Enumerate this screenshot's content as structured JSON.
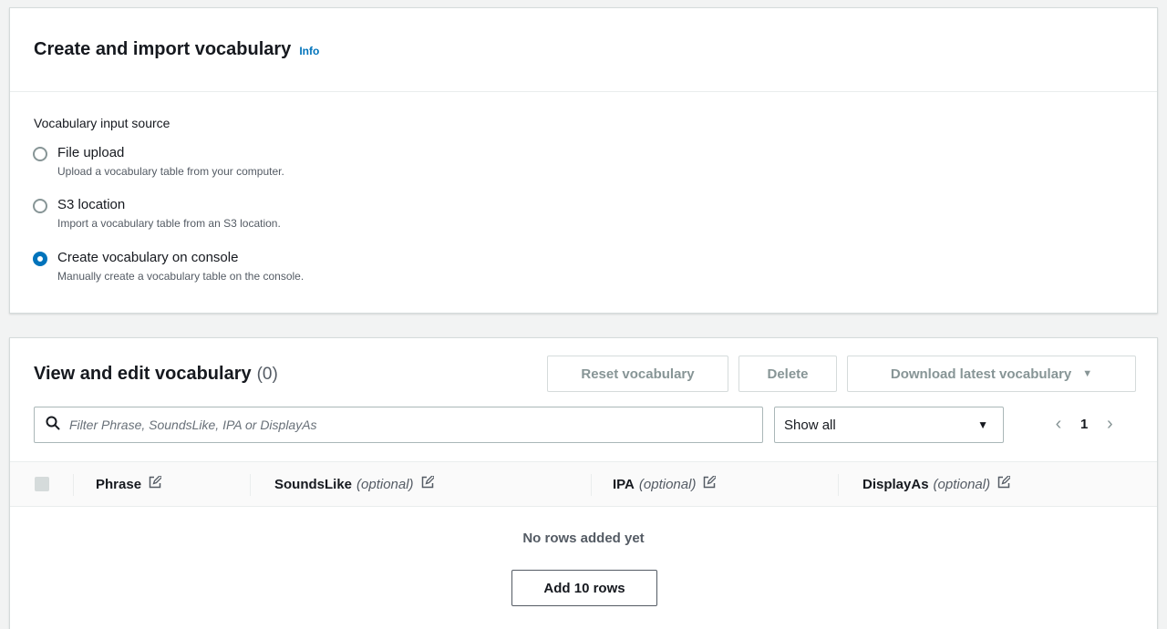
{
  "create_panel": {
    "title": "Create and import vocabulary",
    "info_link": "Info",
    "input_source_label": "Vocabulary input source",
    "options": [
      {
        "title": "File upload",
        "description": "Upload a vocabulary table from your computer.",
        "checked": false
      },
      {
        "title": "S3 location",
        "description": "Import a vocabulary table from an S3 location.",
        "checked": false
      },
      {
        "title": "Create vocabulary on console",
        "description": "Manually create a vocabulary table on the console.",
        "checked": true
      }
    ]
  },
  "edit_panel": {
    "title": "View and edit vocabulary",
    "count": "(0)",
    "buttons": {
      "reset": "Reset vocabulary",
      "delete": "Delete",
      "download": "Download latest vocabulary"
    },
    "filter": {
      "placeholder": "Filter Phrase, SoundsLike, IPA or DisplayAs",
      "value": ""
    },
    "show_select": {
      "selected": "Show all"
    },
    "pagination": {
      "current_page": "1"
    },
    "table": {
      "columns": [
        {
          "name": "Phrase",
          "optional": ""
        },
        {
          "name": "SoundsLike",
          "optional": "(optional)"
        },
        {
          "name": "IPA",
          "optional": "(optional)"
        },
        {
          "name": "DisplayAs",
          "optional": "(optional)"
        }
      ],
      "empty_message": "No rows added yet",
      "add_rows_label": "Add 10 rows"
    }
  },
  "colors": {
    "accent": "#0073bb",
    "background": "#f2f3f3",
    "disabled_text": "#879596"
  }
}
